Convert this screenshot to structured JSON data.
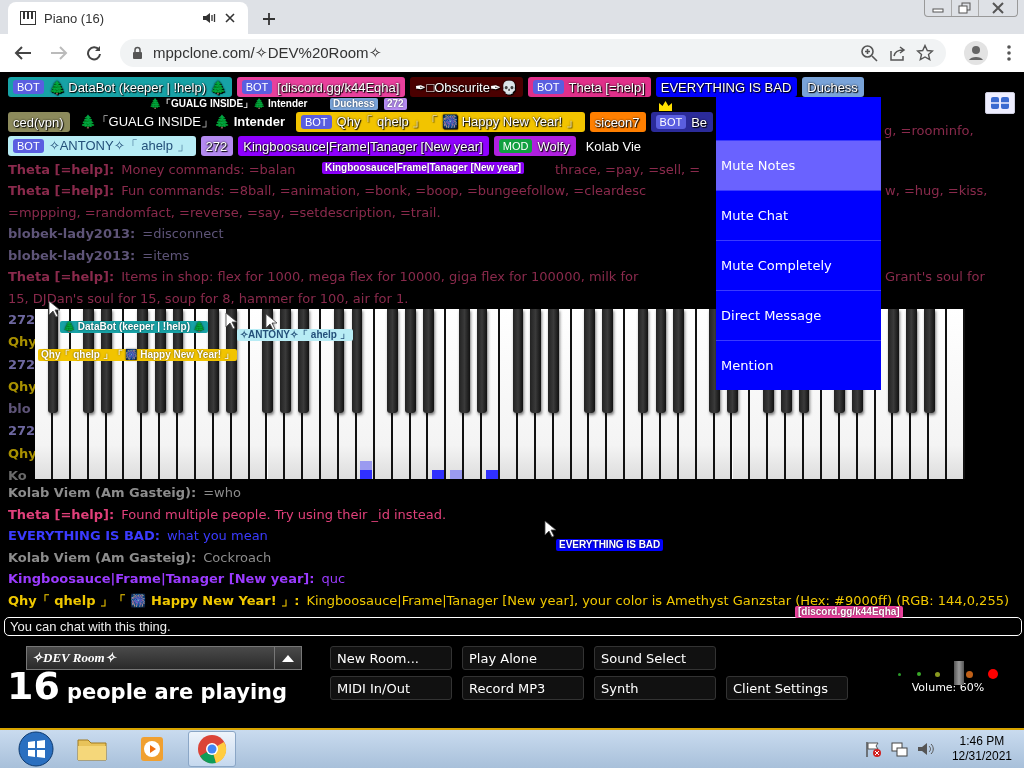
{
  "browser": {
    "tab": {
      "title": "Piano (16)",
      "selected": true
    },
    "url": "mppclone.com/✧DEV%20Room✧"
  },
  "participant_rows": [
    [
      {
        "badge": {
          "text": "BOT",
          "color": "#5a5ee0"
        },
        "name": "🌲 DataBot (keeper | !help) 🌲",
        "color": "#17a2a6",
        "crown": false
      },
      {
        "badge": {
          "text": "BOT",
          "color": "#5a5ee0"
        },
        "name": "[discord.gg/k44Eqha]",
        "color": "#e8409c",
        "crown": false
      },
      {
        "name": "✒□Obscurite✒💀",
        "color": "#4a0000",
        "crown": false
      },
      {
        "badge": {
          "text": "BOT",
          "color": "#5a5ee0"
        },
        "name": "Theta [=help]",
        "color": "#e0308a",
        "crown": false
      },
      {
        "name": "EVERYTHING IS BAD",
        "color": "#0000ff",
        "crown": false,
        "menu_open": true
      },
      {
        "name": "Duchess",
        "color": "#79a3d8",
        "crown": false
      }
    ],
    [
      {
        "name": "ced(vpn)",
        "color": "#8c8a5c",
        "crown": false
      },
      {
        "name": "🌲「GUALG INSIDE」🌲 **Intender**",
        "color": "#000000",
        "crown": false
      },
      {
        "badge": {
          "text": "BOT",
          "color": "#5a5ee0"
        },
        "name": "Qhy「 qhelp 」「 🎆 Happy New Year! 」",
        "color": "#f2c400",
        "crown": false
      },
      {
        "name": "siceon7",
        "color": "#ff7f00",
        "crown": false
      },
      {
        "badge": {
          "text": "BOT",
          "color": "#5a5ee0"
        },
        "name": "Be",
        "color": "#2b2b9a",
        "crown": true
      }
    ],
    [
      {
        "badge": {
          "text": "BOT",
          "color": "#5a5ee0"
        },
        "name": "✧ANTONY✧「 ahelp 」",
        "color": "#b8ecf5",
        "crown": false
      },
      {
        "name": "272",
        "color": "#b48af0",
        "crown": false
      },
      {
        "name": "Kingboosauce|Frame|Tanager [New year]",
        "color": "#8f00ff",
        "crown": false
      },
      {
        "badge": {
          "text": "MOD",
          "color": "#10a040"
        },
        "name": "Wolfy",
        "color": "#b020e0",
        "crown": false
      },
      {
        "name": "Kolab Vie",
        "color": "#000000",
        "crown": false
      }
    ]
  ],
  "user_menu": {
    "items": [
      {
        "label": "Mute Notes",
        "highlighted": true
      },
      {
        "label": "Mute Chat",
        "highlighted": false
      },
      {
        "label": "Mute Completely",
        "highlighted": false
      },
      {
        "label": "Direct Message",
        "highlighted": false
      },
      {
        "label": "Mention",
        "highlighted": false
      }
    ]
  },
  "chat_top": [
    {
      "kind": "right",
      "color": "#8a2a4c",
      "segments": [
        "g, =roominfo,"
      ]
    },
    {
      "kind": "around-label",
      "name": "Theta [=help]:",
      "color": "#8a2a4c",
      "segments": [
        "Money commands: =balan",
        "thrace, =pay, =sell, ="
      ]
    },
    {
      "kind": "around-menu",
      "name": "Theta [=help]:",
      "color": "#8a2a4c",
      "segments": [
        "Fun commands: =8ball, =animation, =bonk, =boop, =bungeefollow, =cleardesc",
        "w, =hug, =kiss,",
        "=mppping, =randomfact, =reverse, =say, =setdescription, =trail."
      ]
    },
    {
      "kind": "plain",
      "name": "blobek-lady2013:",
      "color": "#5e5478",
      "segments": [
        "=disconnect"
      ]
    },
    {
      "kind": "plain",
      "name": "blobek-lady2013:",
      "color": "#5e5478",
      "segments": [
        "=items"
      ]
    },
    {
      "kind": "around-menu",
      "name": "Theta [=help]:",
      "color": "#8a2a4c",
      "segments": [
        "Items in shop: flex for 1000, mega flex for 10000, giga flex for 100000, milk for",
        "Grant's soul for",
        "15, DJDan's soul for 15, soup for 8, hammer for 100, air for 1."
      ]
    }
  ],
  "hidden_chat": [
    {
      "text": "272",
      "color": "#6e68a0"
    },
    {
      "text": "Qhy",
      "color": "#a89000"
    },
    {
      "text": "272",
      "color": "#6e68a0"
    },
    {
      "text": "Qhy",
      "color": "#a89000"
    },
    {
      "text": "blo",
      "color": "#5e5478"
    },
    {
      "text": "272",
      "color": "#6e68a0"
    },
    {
      "text": "Qhy",
      "color": "#a89000"
    },
    {
      "text": "Ko",
      "color": "#6a6a6a"
    }
  ],
  "chat_bottom": [
    {
      "kind": "plain",
      "name": "Kolab Viem (Am Gasteig):",
      "color": "#8c8c8c",
      "segments": [
        "=who"
      ]
    },
    {
      "kind": "plain",
      "name": "Theta [=help]:",
      "color": "#e0407a",
      "segments": [
        "Found multiple people. Try using their _id instead."
      ]
    },
    {
      "kind": "plain",
      "name": "EVERYTHING IS BAD:",
      "color": "#3b3bff",
      "segments": [
        "what you mean"
      ]
    },
    {
      "kind": "plain",
      "name": "Kolab Viem (Am Gasteig):",
      "color": "#8c8c8c",
      "segments": [
        "Cockroach"
      ]
    },
    {
      "kind": "plain",
      "name": "Kingboosauce|Frame|Tanager [New year]:",
      "color": "#9b3bff",
      "segments": [
        "quc"
      ]
    },
    {
      "kind": "plain",
      "name": "Qhy「 qhelp 」「 🎆 Happy New Year! 」:",
      "color": "#f0c800",
      "segments": [
        "Kingboosauce|Frame|Tanager [New year], your color is Amethyst Ganzstar (Hex: #9000ff) (RGB: 144,0,255)"
      ]
    }
  ],
  "cursors": [
    {
      "label": "🌲「GUALG INSIDE」🌲 **Intender**",
      "color": "#000000"
    },
    {
      "label": "Duchess",
      "color": "#79a3d8"
    },
    {
      "label": "272",
      "color": "#b48af0"
    },
    {
      "label": "Kingboosauce|Frame|Tanager [New year]",
      "color": "#8f00ff"
    },
    {
      "label": "🌲 DataBot (keeper | !help) 🌲",
      "color": "#17a2a6"
    },
    {
      "label": "✧ANTONY✧「 ahelp 」",
      "color": "#b8ecf5"
    },
    {
      "label": "Qhy「 qhelp 」「 🎆 Happy New Year! 」",
      "color": "#f2c400"
    },
    {
      "label": "EVERYTHING IS BAD",
      "color": "#0000ff"
    },
    {
      "label": "[discord.gg/k44Eqha]",
      "color": "#e8409c"
    }
  ],
  "chat_input": {
    "placeholder": "You can chat with this thing."
  },
  "room": {
    "name": "✧DEV Room✧"
  },
  "player_count": {
    "count": "16",
    "label": "people are playing"
  },
  "buttons": [
    "New Room...",
    "Play Alone",
    "Sound Select",
    "MIDI In/Out",
    "Record MP3",
    "Synth",
    "Client Settings"
  ],
  "volume": {
    "label": "Volume: 60%",
    "level": 0.6
  },
  "taskbar": {
    "apps": [
      {
        "kind": "explorer",
        "selected": false
      },
      {
        "kind": "media",
        "selected": false
      },
      {
        "kind": "browser",
        "selected": true
      }
    ],
    "time": "1:46 PM",
    "date": "12/31/2021"
  }
}
